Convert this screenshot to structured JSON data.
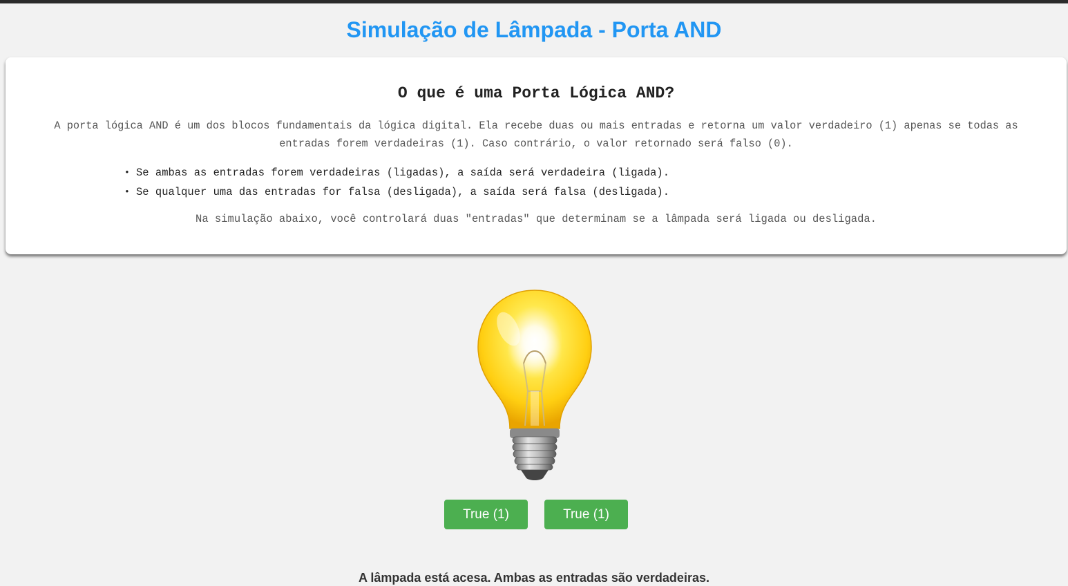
{
  "page": {
    "title": "Simulação de Lâmpada - Porta AND"
  },
  "info": {
    "heading": "O que é uma Porta Lógica AND?",
    "paragraph": "A porta lógica AND é um dos blocos fundamentais da lógica digital. Ela recebe duas ou mais entradas e retorna um valor verdadeiro (1) apenas se todas as entradas forem verdadeiras (1). Caso contrário, o valor retornado será falso (0).",
    "rules": [
      "Se ambas as entradas forem verdadeiras (ligadas), a saída será verdadeira (ligada).",
      "Se qualquer uma das entradas for falsa (desligada), a saída será falsa (desligada)."
    ],
    "note": "Na simulação abaixo, você controlará duas \"entradas\" que determinam se a lâmpada será ligada ou desligada."
  },
  "simulation": {
    "bulb_state": "on",
    "bulb_icon": "lightbulb-on-icon",
    "input_a_label": "True (1)",
    "input_b_label": "True (1)",
    "status": "A lâmpada está acesa. Ambas as entradas são verdadeiras."
  },
  "colors": {
    "title": "#2196f3",
    "button": "#4caf50",
    "background": "#f2f2f2",
    "bulb_glass": "#ffd21f"
  }
}
